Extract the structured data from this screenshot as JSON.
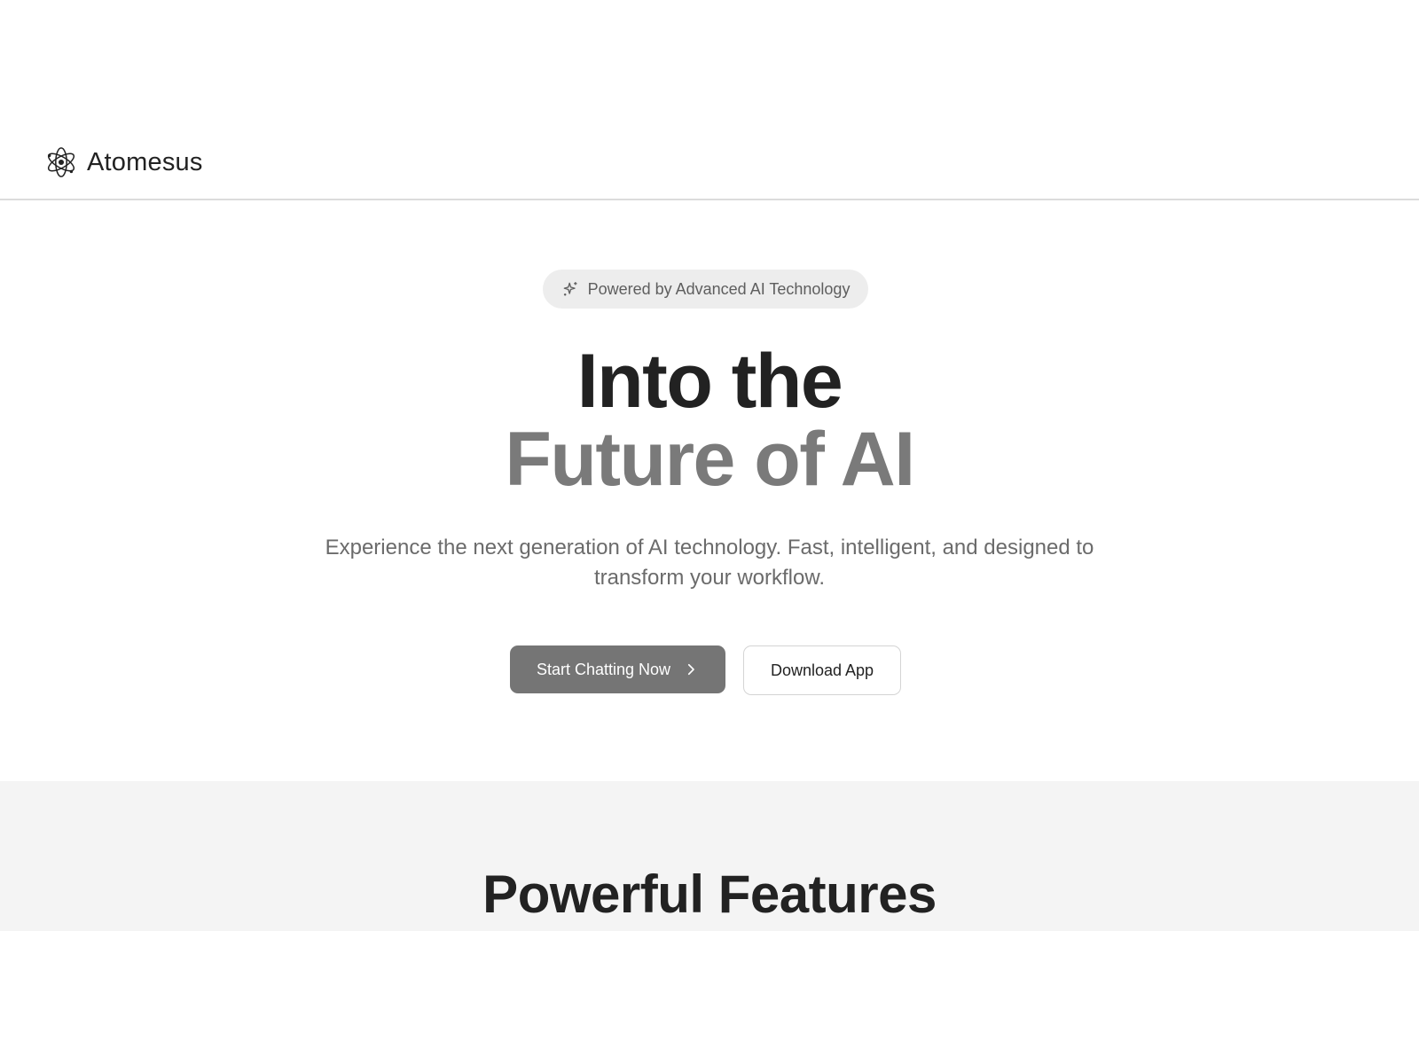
{
  "header": {
    "brand_name": "Atomesus",
    "logo_icon": "atom-icon"
  },
  "hero": {
    "badge_text": "Powered by Advanced AI Technology",
    "badge_icon": "sparkles-icon",
    "headline_line1": "Into the",
    "headline_line2": "Future of AI",
    "subtitle": "Experience the next generation of AI technology. Fast, intelligent, and designed to transform your workflow.",
    "primary_cta_label": "Start Chatting Now",
    "primary_cta_icon": "chevron-right-icon",
    "secondary_cta_label": "Download App"
  },
  "features": {
    "title": "Powerful Features"
  },
  "colors": {
    "text_primary": "#222222",
    "text_muted": "#7a7a7a",
    "subtitle": "#6b6b6b",
    "primary_button": "#757575",
    "badge_bg": "#ededed",
    "features_bg": "#f4f4f4",
    "divider": "#dcdcdc"
  }
}
